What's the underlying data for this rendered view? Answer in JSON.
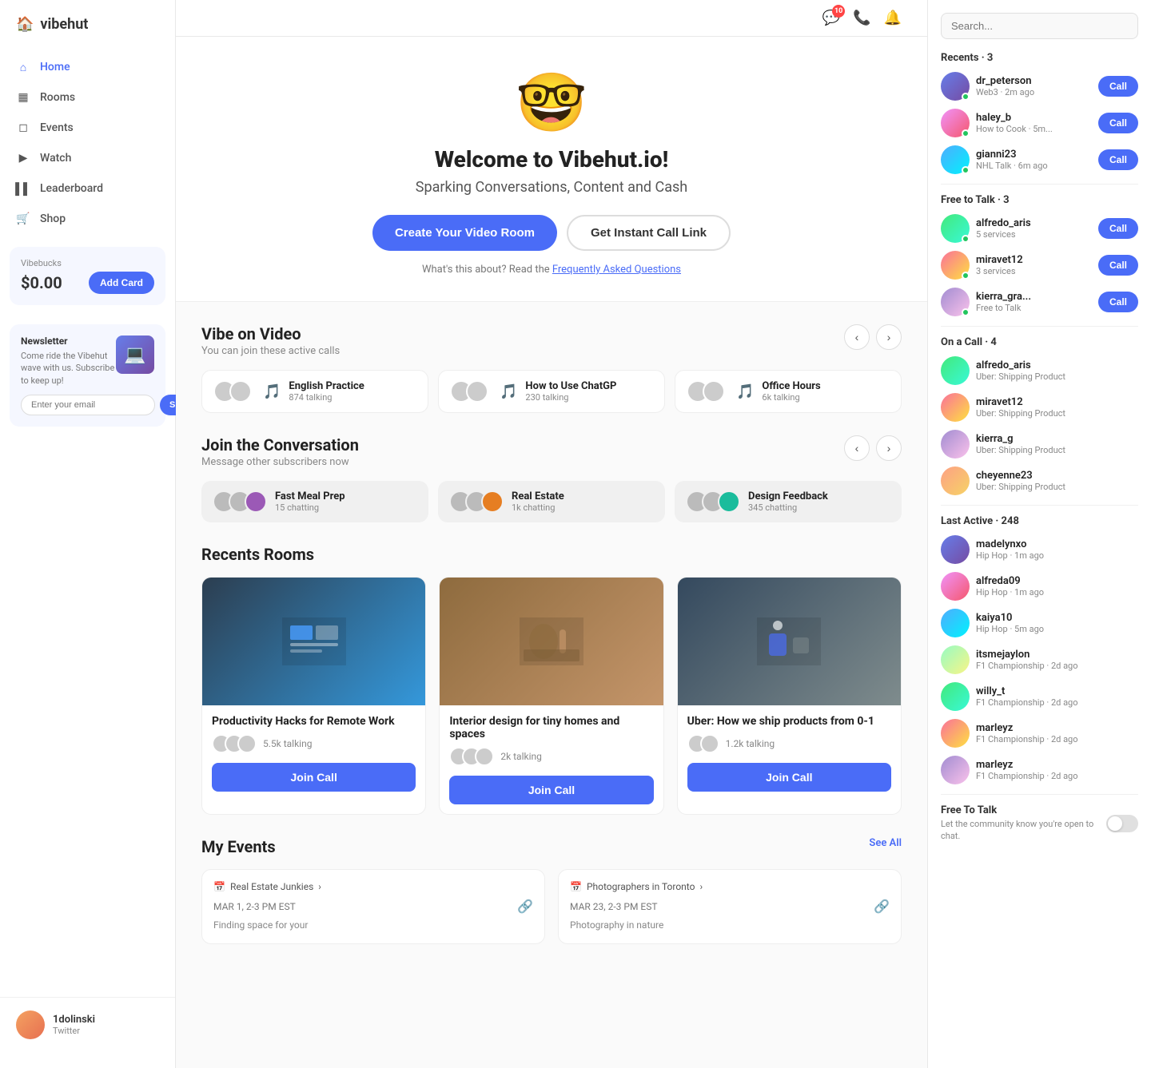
{
  "app": {
    "name": "vibehut",
    "logo_emoji": "🏠"
  },
  "sidebar": {
    "nav_items": [
      {
        "label": "Home",
        "icon": "home",
        "active": true
      },
      {
        "label": "Rooms",
        "icon": "rooms",
        "active": false
      },
      {
        "label": "Events",
        "icon": "events",
        "active": false
      },
      {
        "label": "Watch",
        "icon": "watch",
        "active": false
      },
      {
        "label": "Leaderboard",
        "icon": "leaderboard",
        "active": false
      },
      {
        "label": "Shop",
        "icon": "shop",
        "active": false
      }
    ],
    "vibebucks": {
      "label": "Vibebucks",
      "amount": "$0.00",
      "add_card_label": "Add Card"
    },
    "newsletter": {
      "title": "Newsletter",
      "text": "Come ride the Vibehut wave with us. Subscribe to keep up!",
      "placeholder": "Enter your email",
      "subscribe_label": "Subscribe"
    },
    "user": {
      "name": "1dolinski",
      "platform": "Twitter"
    }
  },
  "topbar": {
    "notification_count": "10"
  },
  "hero": {
    "title": "Welcome to Vibehut.io!",
    "subtitle": "Sparking Conversations, Content and Cash",
    "create_room_label": "Create Your Video Room",
    "instant_call_label": "Get Instant Call Link",
    "faq_text": "What's this about? Read the",
    "faq_link_label": "Frequently Asked Questions"
  },
  "vibe_on_video": {
    "title": "Vibe on Video",
    "subtitle": "You can join these active calls",
    "calls": [
      {
        "name": "English Practice",
        "count": "874 talking"
      },
      {
        "name": "How to Use ChatGP",
        "count": "230 talking"
      },
      {
        "name": "Office Hours",
        "count": "6k talking"
      }
    ]
  },
  "join_conversation": {
    "title": "Join the Conversation",
    "subtitle": "Message other subscribers now",
    "chats": [
      {
        "name": "Fast Meal Prep",
        "count": "15 chatting"
      },
      {
        "name": "Real Estate",
        "count": "1k chatting"
      },
      {
        "name": "Design Feedback",
        "count": "345 chatting"
      }
    ]
  },
  "recent_rooms": {
    "title": "Recents Rooms",
    "rooms": [
      {
        "name": "Productivity Hacks for Remote Work",
        "talking": "5.5k talking",
        "join_label": "Join Call"
      },
      {
        "name": "Interior design for tiny homes and spaces",
        "talking": "2k talking",
        "join_label": "Join Call"
      },
      {
        "name": "Uber: How we ship products from 0-1",
        "talking": "1.2k talking",
        "join_label": "Join Call"
      }
    ]
  },
  "my_events": {
    "title": "My Events",
    "see_all": "See All",
    "events": [
      {
        "group": "Real Estate Junkies",
        "date": "MAR 1, 2-3 PM EST",
        "description": "Finding space for your"
      },
      {
        "group": "Photographers in Toronto",
        "date": "MAR 23, 2-3 PM EST",
        "description": "Photography in nature"
      }
    ]
  },
  "right_panel": {
    "search_placeholder": "Search...",
    "recents_label": "Recents · 3",
    "recents": [
      {
        "name": "dr_peterson",
        "sub": "Web3 · 2m ago"
      },
      {
        "name": "haley_b",
        "sub": "How to Cook · 5m..."
      },
      {
        "name": "gianni23",
        "sub": "NHL Talk · 6m ago"
      }
    ],
    "free_to_talk_label": "Free to Talk · 3",
    "free_to_talk": [
      {
        "name": "alfredo_aris",
        "sub": "5 services"
      },
      {
        "name": "miravet12",
        "sub": "3 services"
      },
      {
        "name": "kierra_gra...",
        "sub": "Free to Talk"
      }
    ],
    "on_a_call_label": "On a Call · 4",
    "on_a_call": [
      {
        "name": "alfredo_aris",
        "sub": "Uber: Shipping Product"
      },
      {
        "name": "miravet12",
        "sub": "Uber: Shipping Product"
      },
      {
        "name": "kierra_g",
        "sub": "Uber: Shipping Product"
      },
      {
        "name": "cheyenne23",
        "sub": "Uber: Shipping Product"
      }
    ],
    "last_active_label": "Last Active · 248",
    "last_active": [
      {
        "name": "madelynxo",
        "sub": "Hip Hop · 1m ago"
      },
      {
        "name": "alfreda09",
        "sub": "Hip Hop · 1m ago"
      },
      {
        "name": "kaiya10",
        "sub": "Hip Hop · 5m ago"
      },
      {
        "name": "itsmejaylon",
        "sub": "F1 Championship · 2d ago"
      },
      {
        "name": "willy_t",
        "sub": "F1 Championship · 2d ago"
      },
      {
        "name": "marleyz",
        "sub": "F1 Championship · 2d ago"
      },
      {
        "name": "marleyz",
        "sub": "F1 Championship · 2d ago"
      }
    ],
    "free_to_talk_toggle": {
      "title": "Free To Talk",
      "description": "Let the community know you're open to chat."
    }
  }
}
